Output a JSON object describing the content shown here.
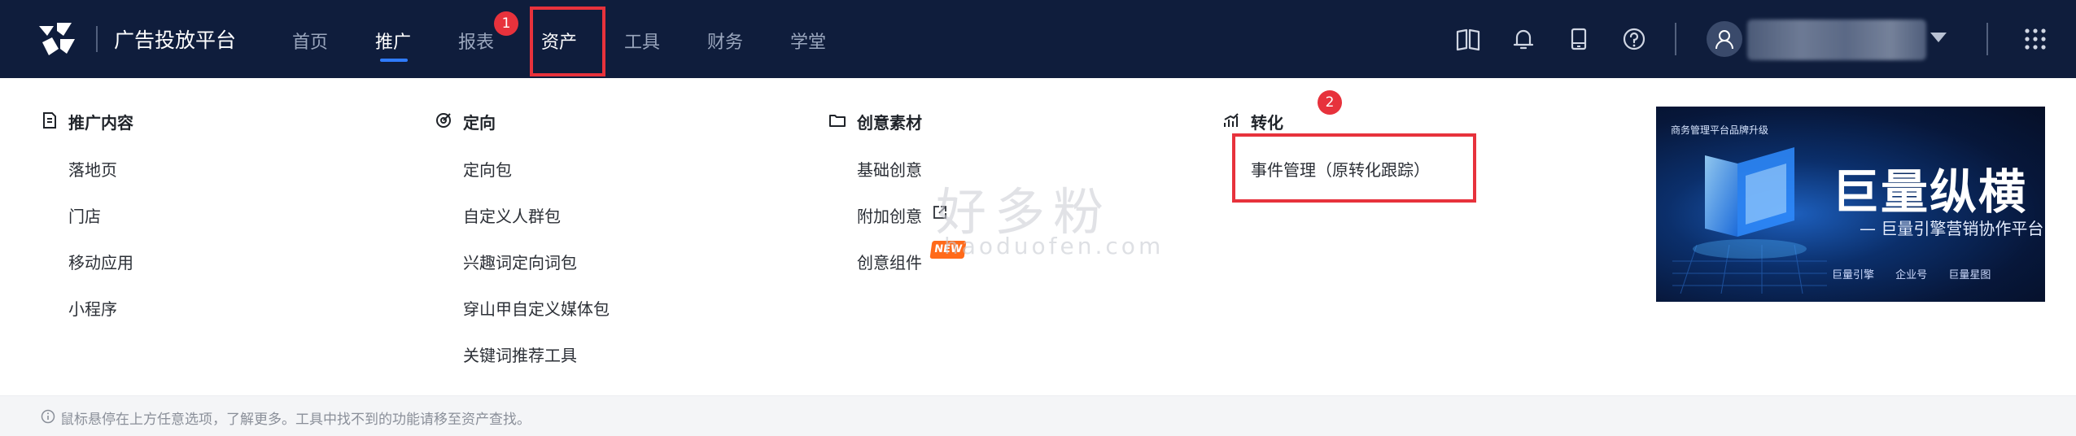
{
  "navbar": {
    "brand": "广告投放平台",
    "items": [
      {
        "label": "首页",
        "active": false
      },
      {
        "label": "推广",
        "active": true
      },
      {
        "label": "报表",
        "active": false
      },
      {
        "label": "资产",
        "active": false
      },
      {
        "label": "工具",
        "active": false
      },
      {
        "label": "财务",
        "active": false
      },
      {
        "label": "学堂",
        "active": false
      }
    ],
    "icons": [
      "book-icon",
      "bell-icon",
      "tablet-icon",
      "help-icon",
      "apps-grid-icon"
    ],
    "accent": "#2f7bff",
    "background": "#0f1d3c"
  },
  "annotations": {
    "badge1": "1",
    "badge2": "2",
    "color": "#e7323c"
  },
  "dropdown": {
    "columns": [
      {
        "heading": "推广内容",
        "icon": "document-icon",
        "items": [
          "落地页",
          "门店",
          "移动应用",
          "小程序"
        ]
      },
      {
        "heading": "定向",
        "icon": "target-icon",
        "items": [
          "定向包",
          "自定义人群包",
          "兴趣词定向词包",
          "穿山甲自定义媒体包",
          "关键词推荐工具"
        ]
      },
      {
        "heading": "创意素材",
        "icon": "folder-icon",
        "items": [
          "基础创意",
          "附加创意",
          "创意组件"
        ]
      },
      {
        "heading": "转化",
        "icon": "chart-icon",
        "items": [
          "事件管理（原转化跟踪）"
        ]
      }
    ],
    "new_tag": "NEW",
    "watermark": "好多粉",
    "watermark_sub": "haoduofen.com"
  },
  "banner": {
    "top_text": "商务管理平台品牌升级",
    "title": "巨量纵横",
    "subtitle": "— 巨量引擎营销协作平台 —",
    "brands": [
      "巨量引擎",
      "企业号",
      "巨量星图"
    ]
  },
  "footer": {
    "text": "鼠标悬停在上方任意选项，了解更多。工具中找不到的功能请移至资产查找。"
  }
}
